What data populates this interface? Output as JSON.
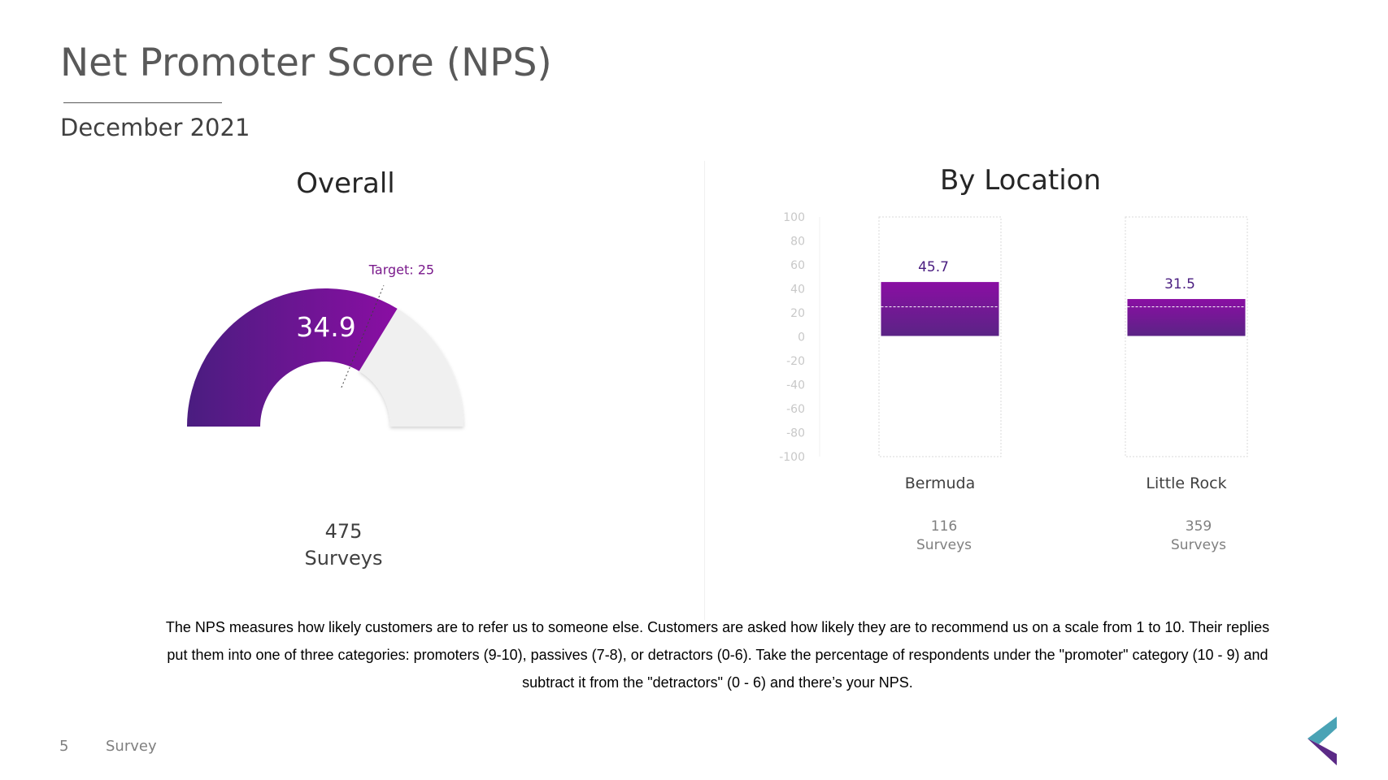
{
  "title": "Net Promoter Score (NPS)",
  "subtitle": "December 2021",
  "overall": {
    "heading": "Overall",
    "score": "34.9",
    "target_label": "Target: 25",
    "count": "475",
    "count_unit": "Surveys"
  },
  "by_location": {
    "heading": "By Location",
    "locations": [
      {
        "name": "Bermuda",
        "value_label": "45.7",
        "count": "116",
        "count_unit": "Surveys"
      },
      {
        "name": "Little Rock",
        "value_label": "31.5",
        "count": "359",
        "count_unit": "Surveys"
      }
    ]
  },
  "description": "The NPS measures how likely customers are to refer us to someone else. Customers are asked how likely they are to recommend us on a scale from 1 to 10. Their replies put them into one of three categories: promoters (9-10), passives (7-8), or detractors (0-6). Take the percentage of respondents under the \"promoter\" category (10 - 9) and subtract it from the \"detractors\" (0 - 6) and there’s your NPS.",
  "footer": {
    "page_number": "5",
    "label": "Survey"
  },
  "colors": {
    "purple_dark": "#4a1d80",
    "purple_bright": "#8a0ea3",
    "gauge_track": "#f0f0f0",
    "target_label": "#7a1a8c",
    "logo_teal": "#4aa3b5",
    "logo_purple": "#5b2a86"
  },
  "chart_data": [
    {
      "type": "gauge",
      "title": "Overall",
      "value": 34.9,
      "target": 25,
      "range": [
        -100,
        100
      ]
    },
    {
      "type": "bar",
      "title": "By Location",
      "categories": [
        "Bermuda",
        "Little Rock"
      ],
      "values": [
        45.7,
        31.5
      ],
      "target": 25,
      "ylim": [
        -100,
        100
      ],
      "yticks": [
        100,
        80,
        60,
        40,
        20,
        0,
        -20,
        -40,
        -60,
        -80,
        -100
      ]
    }
  ]
}
